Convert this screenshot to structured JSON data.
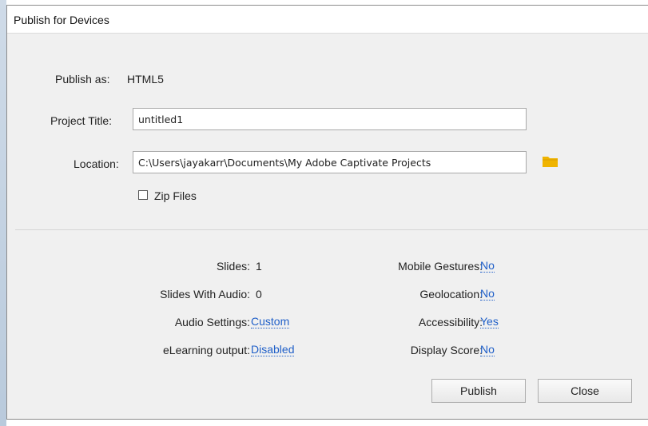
{
  "window": {
    "title": "Publish for Devices"
  },
  "form": {
    "publish_as_label": "Publish as:",
    "publish_as_value": "HTML5",
    "project_title_label": "Project Title:",
    "project_title_value": "untitled1",
    "location_label": "Location:",
    "location_value": "C:\\Users\\jayakarr\\Documents\\My Adobe Captivate Projects",
    "zip_files_label": "Zip Files",
    "zip_files_checked": false
  },
  "summary": {
    "slides_label": "Slides:",
    "slides_value": "1",
    "slides_audio_label": "Slides With Audio:",
    "slides_audio_value": "0",
    "audio_settings_label": "Audio Settings:",
    "audio_settings_value": "Custom",
    "elearning_label": "eLearning output:",
    "elearning_value": "Disabled",
    "mobile_gestures_label": "Mobile Gestures:",
    "mobile_gestures_value": "No",
    "geolocation_label": "Geolocation:",
    "geolocation_value": "No",
    "accessibility_label": "Accessibility:",
    "accessibility_value": "Yes",
    "display_score_label": "Display Score:",
    "display_score_value": "No"
  },
  "buttons": {
    "publish": "Publish",
    "close": "Close"
  },
  "colors": {
    "link": "#1f5fc8",
    "folder": "#f0b400",
    "background": "#f0f0f0"
  },
  "icons": {
    "location_browse": "folder-icon"
  }
}
